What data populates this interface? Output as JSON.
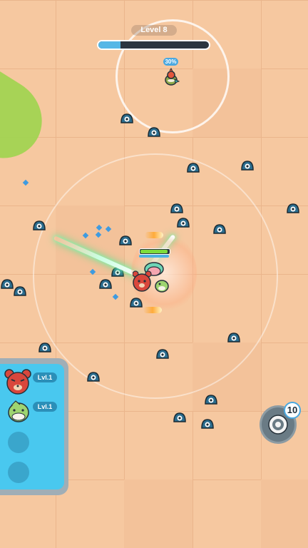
{
  "hud": {
    "level_label": "Level 8",
    "xp_progress": 0.2,
    "target_percent": "30%"
  },
  "colors": {
    "enemy": "#2b6d8e",
    "ground": "#f6c8a0",
    "xp_fill": "#55b7e6",
    "health_fill": "#7ddc3c",
    "panel": "#49c8ef"
  },
  "player": {
    "health_fraction": 0.95
  },
  "party": {
    "members": [
      {
        "name": "red-bear-hero",
        "level": "Lvl.1"
      },
      {
        "name": "green-bird-hero",
        "level": "Lvl.1"
      }
    ],
    "empty_slots": 2
  },
  "ability": {
    "icon": "target-ring-icon",
    "count": "10"
  }
}
